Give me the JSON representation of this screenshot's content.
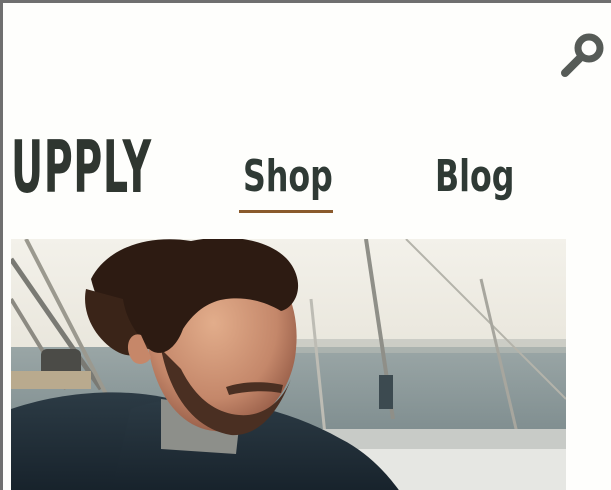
{
  "header": {
    "logo_text": "UPPLY",
    "search_icon": "magnifier-icon"
  },
  "nav": {
    "items": [
      {
        "label": "Shop",
        "active": true
      },
      {
        "label": "Blog",
        "active": false
      }
    ]
  },
  "colors": {
    "background": "#fefefc",
    "text": "#2f3630",
    "active_underline": "#8a5a2c",
    "icon": "#565b57"
  }
}
